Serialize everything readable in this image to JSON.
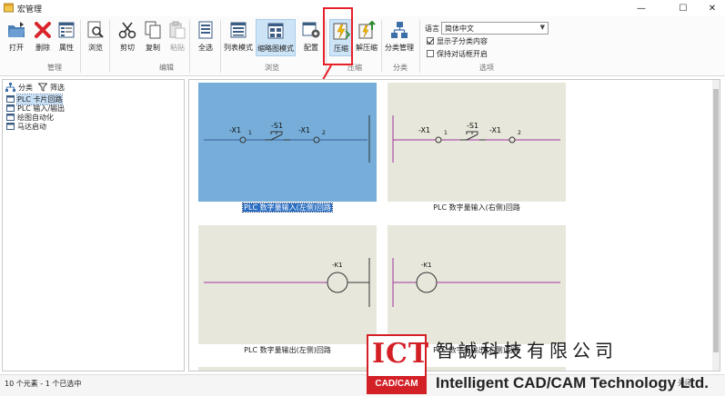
{
  "window": {
    "title": "宏管理",
    "minimize": "—",
    "maximize": "☐",
    "close": "✕"
  },
  "ribbon": {
    "buttons": {
      "open": "打开",
      "delete": "删除",
      "properties": "属性",
      "browse": "浏览",
      "cut": "剪切",
      "copy": "复制",
      "paste": "粘贴",
      "select_all": "全选",
      "list_mode": "列表模式",
      "thumbnail_mode": "缩略图模式",
      "config": "配置",
      "compress": "压缩",
      "decompress": "解压缩",
      "category_manage": "分类管理"
    },
    "groups": {
      "manage": "管理",
      "edit": "编辑",
      "view": "浏览",
      "compress": "压缩",
      "category": "分类",
      "options": "选项"
    },
    "options": {
      "language_label": "语言",
      "language_value": "简体中文",
      "show_sub_category": "显示子分类内容",
      "show_sub_category_checked": true,
      "keep_dialog_open": "保持对话框开启",
      "keep_dialog_open_checked": false
    }
  },
  "left_panel": {
    "tabs": {
      "category": "分类",
      "filter": "筛选"
    },
    "tree": [
      "PLC 卡片回路",
      "PLC 输入/输出",
      "绘图自动化",
      "马达启动"
    ],
    "selected_index": 0
  },
  "thumbnails": [
    {
      "caption": "PLC 数字量输入(左侧)回路",
      "selected": true,
      "labels": [
        "-X1",
        "1",
        "-S1",
        "-X1",
        "2"
      ]
    },
    {
      "caption": "PLC 数字量输入(右侧)回路",
      "selected": false,
      "labels": [
        "-X1",
        "1",
        "-S1",
        "-X1",
        "2"
      ]
    },
    {
      "caption": "PLC 数字量输出(左侧)回路",
      "selected": false,
      "labels": [
        "-K1"
      ]
    },
    {
      "caption": "PLC 数字量输出(右侧)回路",
      "selected": false,
      "labels": [
        "-K1"
      ]
    }
  ],
  "status": {
    "text": "10 个元素 - 1 个已选中",
    "close_button": "关闭"
  },
  "watermark": {
    "logo_big": "ICT",
    "logo_small": "CAD/CAM",
    "company_cn": "智誠科技有限公司",
    "company_en": "Intelligent CAD/CAM Technology Ltd."
  },
  "colors": {
    "accent": "#2c6fc2",
    "annotation": "#e8202a",
    "thumb_bg": "#e8e7dc",
    "thumb_selected": "#76aed9",
    "wire": "#a0369e"
  }
}
